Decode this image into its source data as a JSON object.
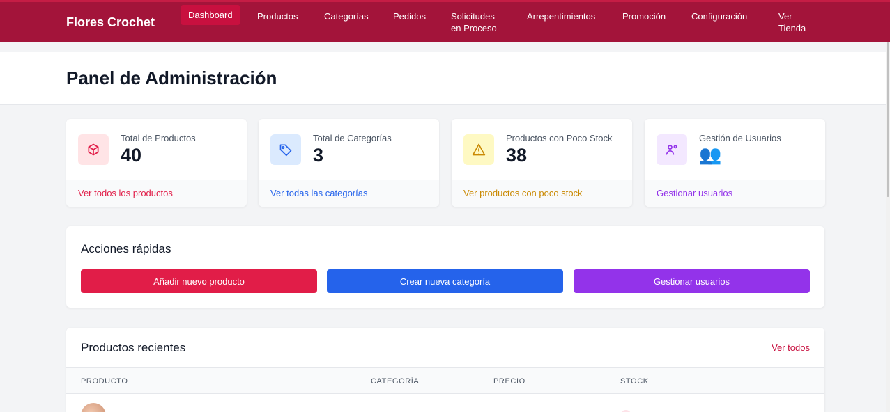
{
  "nav": {
    "brand": "Flores Crochet",
    "links": [
      "Dashboard",
      "Productos",
      "Categorías",
      "Pedidos",
      "Solicitudes en Proceso",
      "Arrepentimientos",
      "Promoción",
      "Configuración",
      "Ver Tienda"
    ],
    "active": "Dashboard"
  },
  "header": {
    "title": "Panel de Administración"
  },
  "stats": [
    {
      "label": "Total de Productos",
      "value": "40",
      "link": "Ver todos los productos",
      "icon": "cube-icon",
      "color": "#e11d48",
      "bg": "#ffe4e6"
    },
    {
      "label": "Total de Categorías",
      "value": "3",
      "link": "Ver todas las categorías",
      "icon": "tag-icon",
      "color": "#2563eb",
      "bg": "#dbeafe"
    },
    {
      "label": "Productos con Poco Stock",
      "value": "38",
      "link": "Ver productos con poco stock",
      "icon": "warning-icon",
      "color": "#ca8a04",
      "bg": "#fef9c3"
    },
    {
      "label": "Gestión de Usuarios",
      "value": "👥",
      "link": "Gestionar usuarios",
      "icon": "user-cog-icon",
      "color": "#9333ea",
      "bg": "#f3e8ff"
    }
  ],
  "quick_actions": {
    "title": "Acciones rápidas",
    "buttons": [
      {
        "label": "Añadir nuevo producto",
        "color": "#e11d48"
      },
      {
        "label": "Crear nueva categoría",
        "color": "#2563eb"
      },
      {
        "label": "Gestionar usuarios",
        "color": "#9333ea"
      }
    ]
  },
  "recent": {
    "title": "Productos recientes",
    "see_all": "Ver todos",
    "columns": [
      "PRODUCTO",
      "CATEGORÍA",
      "PRECIO",
      "STOCK"
    ]
  }
}
